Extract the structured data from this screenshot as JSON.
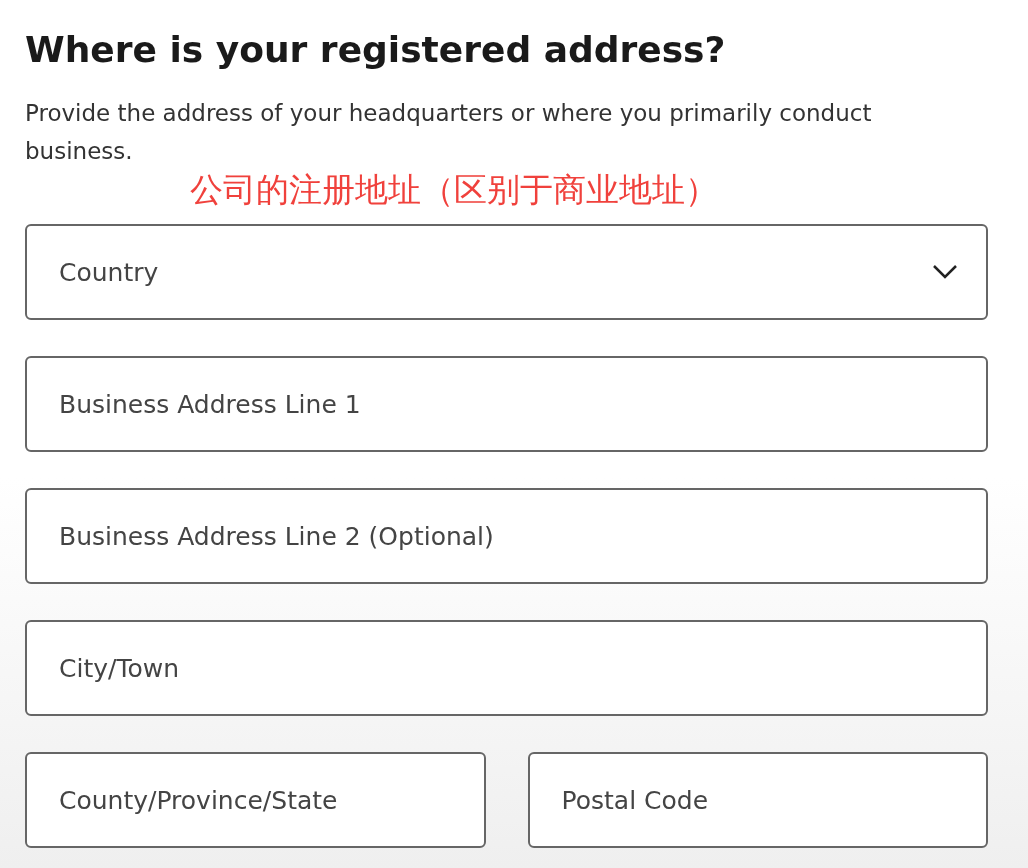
{
  "heading": "Where is your registered address?",
  "description": "Provide the address of your headquarters or where you primarily conduct business.",
  "annotation": "公司的注册地址（区别于商业地址）",
  "rows": [
    [
      {
        "kind": "select",
        "placeholder": "Country"
      }
    ],
    [
      {
        "kind": "text",
        "placeholder": "Business Address Line 1"
      }
    ],
    [
      {
        "kind": "text",
        "placeholder": "Business Address Line 2 (Optional)"
      }
    ],
    [
      {
        "kind": "text",
        "placeholder": "City/Town"
      }
    ],
    [
      {
        "kind": "text",
        "placeholder": "County/Province/State"
      },
      {
        "kind": "text",
        "placeholder": "Postal Code"
      }
    ]
  ]
}
